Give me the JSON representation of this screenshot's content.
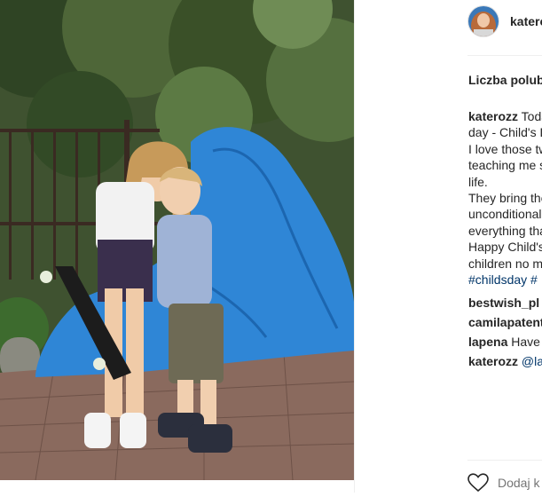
{
  "post": {
    "username": "katerozz",
    "likes_label": "Liczba polubień",
    "caption_lines": [
      "Today is Children's",
      "day - Child's Day",
      "I love those two for",
      "teaching me so much about",
      "life.",
      "They bring the",
      "unconditional love and",
      "everything that",
      "Happy Child's Day to all",
      "children no matter the age"
    ],
    "hashtags": [
      "#childsday",
      "#"
    ],
    "comments": [
      {
        "user": "bestwish_pl",
        "text": ""
      },
      {
        "user": "camilapatent",
        "text": ""
      },
      {
        "user": "lapena",
        "text": "Have"
      },
      {
        "user": "katerozz",
        "mention": "@la",
        "text": ""
      }
    ],
    "add_comment_placeholder": "Dodaj k"
  },
  "colors": {
    "link": "#003569",
    "text": "#262626",
    "tarp": "#2f86d6"
  },
  "icons": {
    "like": "heart-icon"
  }
}
